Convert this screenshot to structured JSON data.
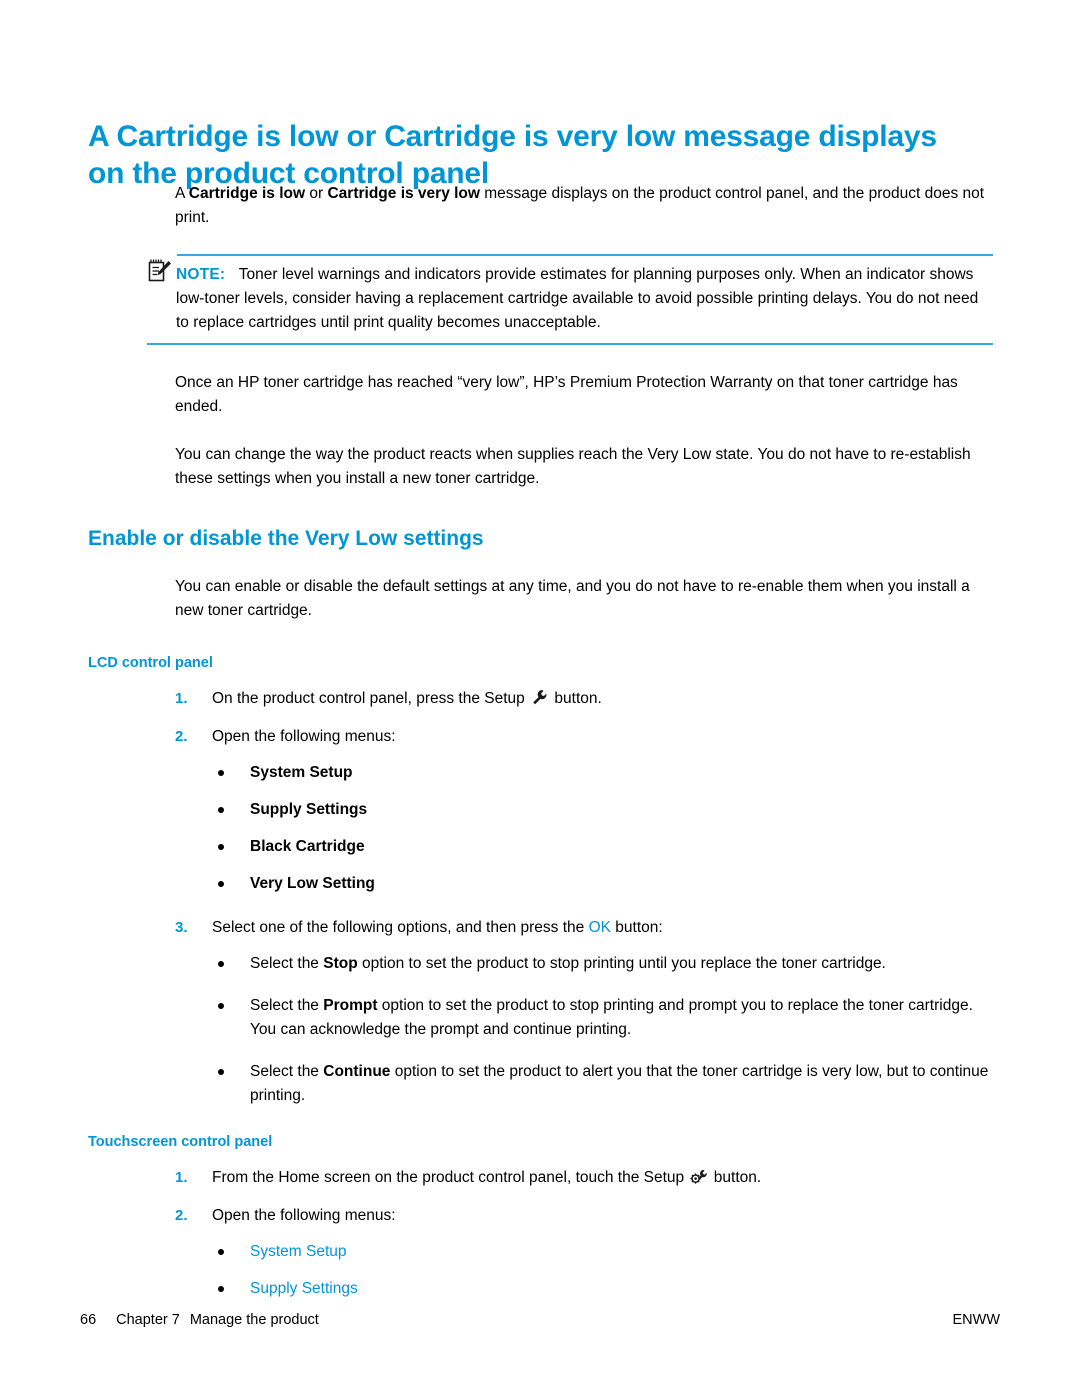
{
  "title": "A Cartridge is low or Cartridge is very low message displays on the product control panel",
  "intro": {
    "part1": "A ",
    "bold1": "Cartridge is low",
    "mid": " or ",
    "bold2": "Cartridge is very low",
    "part2": " message displays on the product control panel, and the product does not print."
  },
  "note": {
    "icon": "note-pad-pencil-icon",
    "label": "NOTE:",
    "text": "Toner level warnings and indicators provide estimates for planning purposes only. When an indicator shows low-toner levels, consider having a replacement cartridge available to avoid possible printing delays. You do not need to replace cartridges until print quality becomes unacceptable."
  },
  "para_warranty": "Once an HP toner cartridge has reached “very low”, HP’s Premium Protection Warranty on that toner cartridge has ended.",
  "para_change": "You can change the way the product reacts when supplies reach the Very Low state. You do not have to re-establish these settings when you install a new toner cartridge.",
  "section_heading": "Enable or disable the Very Low settings",
  "para_enable": "You can enable or disable the default settings at any time, and you do not have to re-enable them when you install a new toner cartridge.",
  "lcd": {
    "heading": "LCD control panel",
    "step1": {
      "num": "1.",
      "text_before": "On the product control panel, press the Setup ",
      "icon": "wrench-icon",
      "text_after": " button."
    },
    "step2": {
      "num": "2.",
      "text": "Open the following menus:"
    },
    "menus": [
      "System Setup",
      "Supply Settings",
      "Black Cartridge",
      "Very Low Setting"
    ],
    "step3": {
      "num": "3.",
      "text_before": "Select one of the following options, and then press the ",
      "keyword": "OK",
      "text_after": " button:"
    },
    "options": [
      {
        "before": "Select the ",
        "bold": "Stop",
        "after": " option to set the product to stop printing until you replace the toner cartridge."
      },
      {
        "before": "Select the ",
        "bold": "Prompt",
        "after": " option to set the product to stop printing and prompt you to replace the toner cartridge. You can acknowledge the prompt and continue printing."
      },
      {
        "before": "Select the ",
        "bold": "Continue",
        "after": " option to set the product to alert you that the toner cartridge is very low, but to continue printing."
      }
    ]
  },
  "touchscreen": {
    "heading": "Touchscreen control panel",
    "step1": {
      "num": "1.",
      "text_before": "From the Home screen on the product control panel, touch the Setup ",
      "icon": "gear-wrench-icon",
      "text_after": " button."
    },
    "step2": {
      "num": "2.",
      "text": "Open the following menus:"
    },
    "menus": [
      "System Setup",
      "Supply Settings"
    ]
  },
  "footer": {
    "page_number": "66",
    "chapter": "Chapter 7",
    "chapter_title": "Manage the product",
    "right": "ENWW"
  },
  "colors": {
    "hp_blue": "#0096d6",
    "note_rule": "#39a8e0"
  }
}
